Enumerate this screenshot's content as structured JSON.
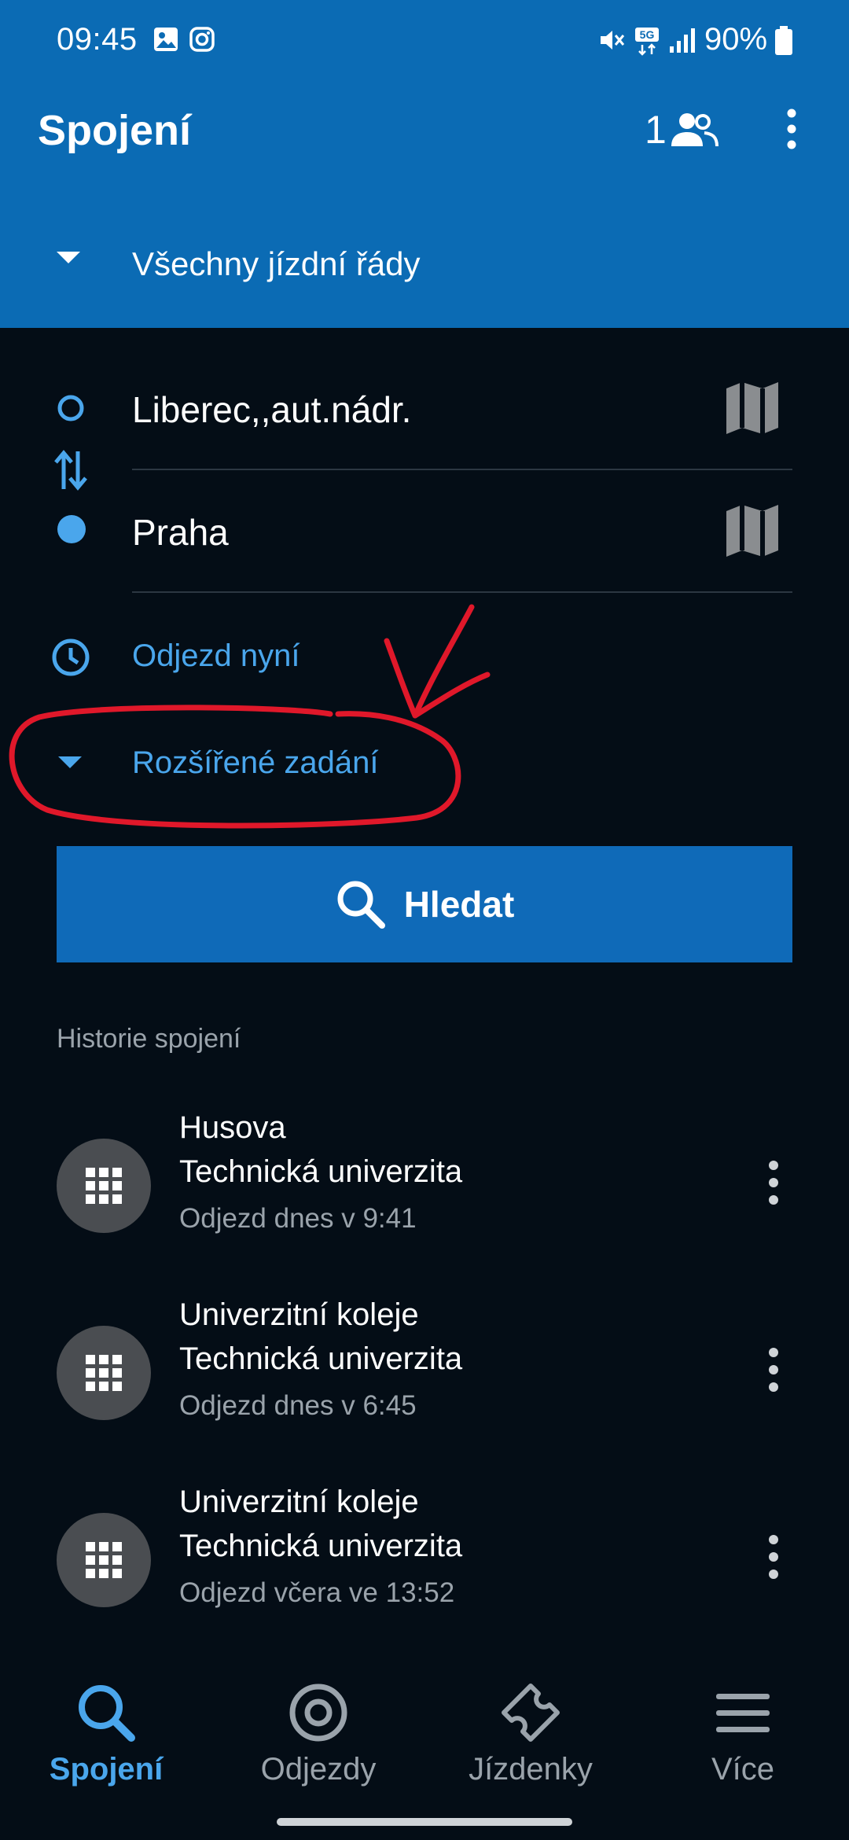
{
  "status_bar": {
    "time": "09:45",
    "battery": "90%",
    "network": "5G"
  },
  "app_bar": {
    "title": "Spojení",
    "passenger_count": "1"
  },
  "timetable_selector": {
    "label": "Všechny jízdní řády"
  },
  "route": {
    "from": "Liberec,,aut.nádr.",
    "to": "Praha"
  },
  "departure": {
    "label": "Odjezd nyní"
  },
  "advanced": {
    "label": "Rozšířené zadání"
  },
  "search_button": {
    "label": "Hledat"
  },
  "history": {
    "title": "Historie spojení",
    "items": [
      {
        "from": "Husova",
        "to": "Technická univerzita",
        "time": "Odjezd dnes v 9:41"
      },
      {
        "from": "Univerzitní koleje",
        "to": "Technická univerzita",
        "time": "Odjezd dnes v 6:45"
      },
      {
        "from": "Univerzitní koleje",
        "to": "Technická univerzita",
        "time": "Odjezd včera ve 13:52"
      }
    ]
  },
  "bottom_nav": {
    "items": [
      {
        "label": "Spojení",
        "icon": "search-icon",
        "active": true
      },
      {
        "label": "Odjezdy",
        "icon": "target-icon",
        "active": false
      },
      {
        "label": "Jízdenky",
        "icon": "ticket-icon",
        "active": false
      },
      {
        "label": "Více",
        "icon": "menu-icon",
        "active": false
      }
    ]
  },
  "colors": {
    "header_blue": "#0b6bb4",
    "background": "#040d16",
    "accent": "#4aa6ec",
    "button": "#0f6ab8",
    "annotation_red": "#e0182a"
  }
}
